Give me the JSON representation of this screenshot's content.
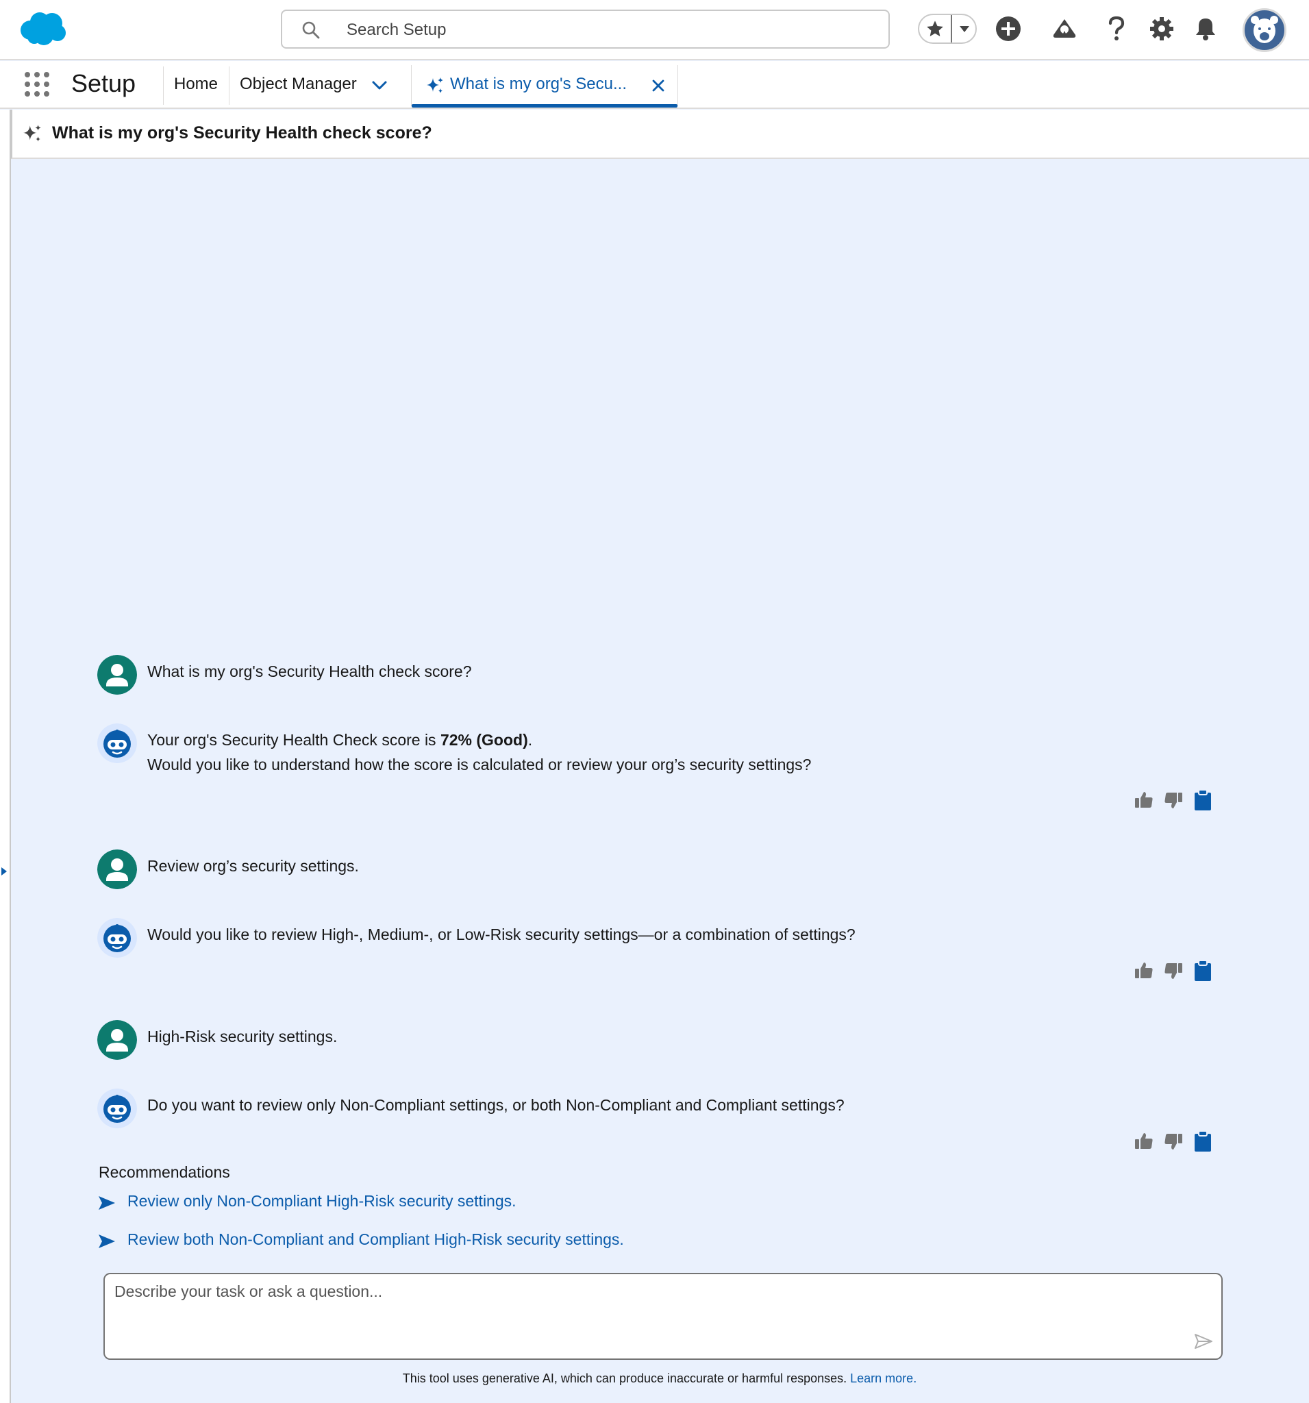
{
  "header": {
    "search_placeholder": "Search Setup",
    "icons": [
      "favorites-star-icon",
      "favorites-dropdown-icon",
      "global-actions-add-icon",
      "trailhead-icon",
      "help-icon",
      "setup-gear-icon",
      "notifications-bell-icon",
      "user-avatar"
    ]
  },
  "nav": {
    "app_name": "Setup",
    "items": [
      {
        "label": "Home"
      },
      {
        "label": "Object Manager"
      }
    ],
    "workspace_tab": {
      "label": "What is my org's Secu..."
    }
  },
  "subheader": {
    "title": "What is my org's Security Health check score?"
  },
  "chat": {
    "messages": [
      {
        "role": "user",
        "text": "What is my org's Security Health check score?"
      },
      {
        "role": "agent",
        "line1_prefix": "Your org's Security Health Check score is ",
        "line1_bold": "72% (Good)",
        "line1_suffix": ".",
        "line2": "Would you like to understand how the score is calculated or review your org’s security settings?"
      },
      {
        "role": "user",
        "text": "Review org’s security settings."
      },
      {
        "role": "agent",
        "text": "Would you like to review High-, Medium-, or Low-Risk security settings—or a combination of settings?"
      },
      {
        "role": "user",
        "text": "High-Risk security settings."
      },
      {
        "role": "agent",
        "text": "Do you want to review only Non-Compliant settings, or both Non-Compliant and Compliant settings?"
      }
    ],
    "recommendations_title": "Recommendations",
    "recommendations": [
      {
        "label": "Review only Non-Compliant High-Risk security settings."
      },
      {
        "label": "Review both Non-Compliant and Compliant High-Risk security settings."
      }
    ],
    "composer_placeholder": "Describe your task or ask a question...",
    "disclaimer": "This tool uses generative AI, which can produce inaccurate or harmful responses.",
    "disclaimer_link": "Learn more."
  },
  "colors": {
    "brand_blue": "#0b5cab",
    "chat_background": "#eaf1fd",
    "user_avatar": "#0d7b6e",
    "agent_avatar": "#0b5cab",
    "salesforce_cloud": "#00a1e0"
  }
}
